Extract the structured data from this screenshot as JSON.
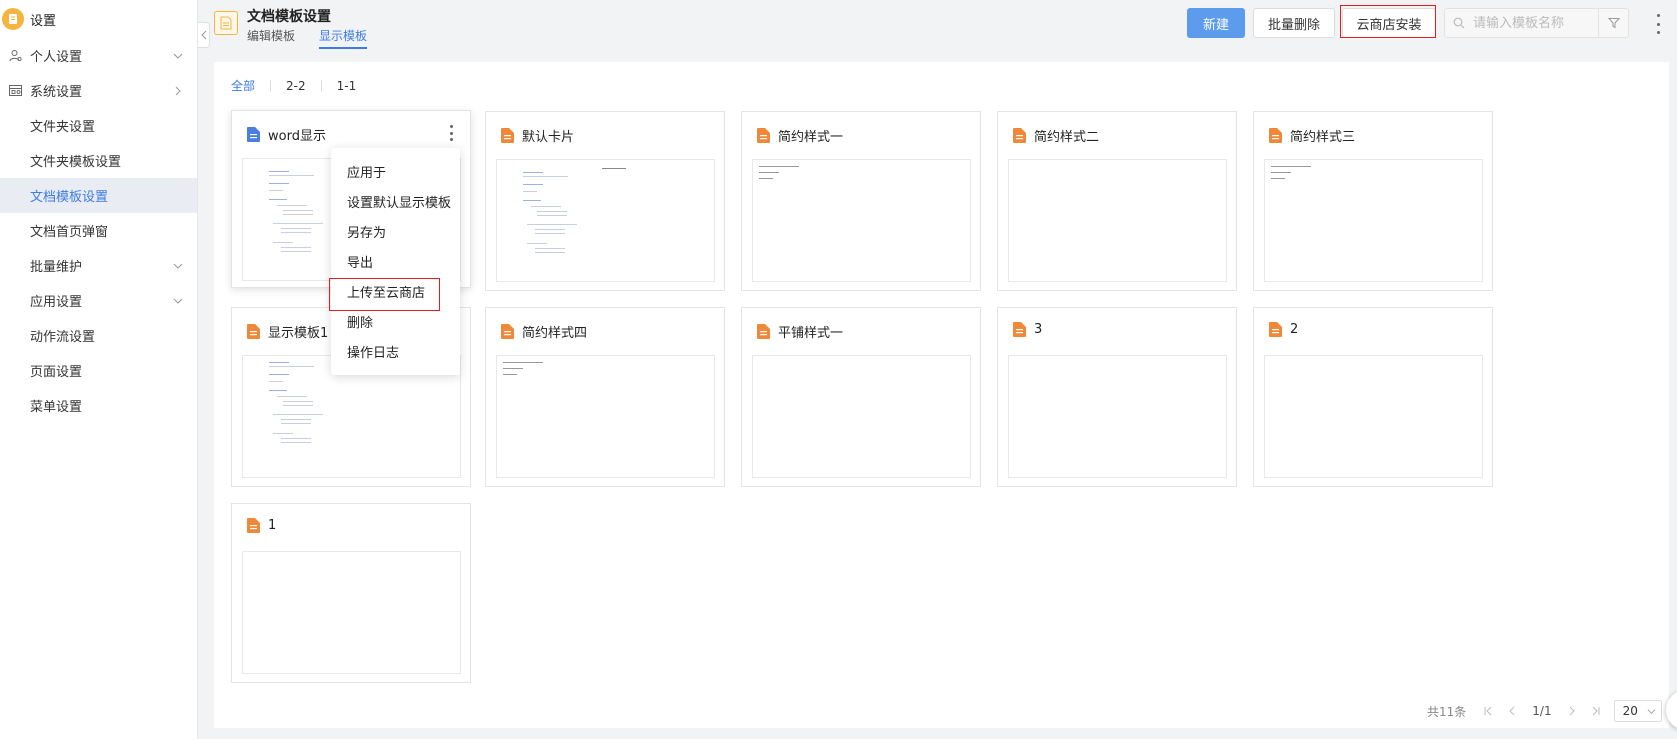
{
  "app": {
    "title": "设置"
  },
  "sidebar": {
    "items": [
      {
        "label": "个人设置",
        "level": "top",
        "icon": "user-icon",
        "chevron": "down"
      },
      {
        "label": "系统设置",
        "level": "top",
        "icon": "system-icon",
        "chevron": "right"
      },
      {
        "label": "文件夹设置",
        "level": "sub"
      },
      {
        "label": "文件夹模板设置",
        "level": "sub"
      },
      {
        "label": "文档模板设置",
        "level": "sub",
        "active": true
      },
      {
        "label": "文档首页弹窗",
        "level": "sub"
      },
      {
        "label": "批量维护",
        "level": "sub",
        "chevron": "down"
      },
      {
        "label": "应用设置",
        "level": "sub",
        "chevron": "down"
      },
      {
        "label": "动作流设置",
        "level": "sub"
      },
      {
        "label": "页面设置",
        "level": "sub"
      },
      {
        "label": "菜单设置",
        "level": "sub"
      }
    ]
  },
  "header": {
    "title": "文档模板设置",
    "tabs": [
      {
        "label": "编辑模板",
        "active": false
      },
      {
        "label": "显示模板",
        "active": true
      }
    ],
    "new_label": "新建",
    "batch_delete_label": "批量删除",
    "cloud_install_label": "云商店安装",
    "search_placeholder": "请输入模板名称"
  },
  "filters": [
    {
      "label": "全部",
      "active": true
    },
    {
      "label": "2-2",
      "active": false
    },
    {
      "label": "1-1",
      "active": false
    }
  ],
  "cards": [
    {
      "name": "word显示",
      "icon": "word-doc-icon"
    },
    {
      "name": "默认卡片",
      "icon": "doc-icon"
    },
    {
      "name": "简约样式一",
      "icon": "doc-icon"
    },
    {
      "name": "简约样式二",
      "icon": "doc-icon"
    },
    {
      "name": "简约样式三",
      "icon": "doc-icon"
    },
    {
      "name": "显示模板1",
      "icon": "doc-icon"
    },
    {
      "name": "简约样式四",
      "icon": "doc-icon"
    },
    {
      "name": "平铺样式一",
      "icon": "doc-icon"
    },
    {
      "name": "3",
      "icon": "doc-icon"
    },
    {
      "name": "2",
      "icon": "doc-icon"
    },
    {
      "name": "1",
      "icon": "doc-icon"
    }
  ],
  "context_menu": {
    "items": [
      "应用于",
      "设置默认显示模板",
      "另存为",
      "导出",
      "上传至云商店",
      "删除",
      "操作日志"
    ]
  },
  "pagination": {
    "total_label": "共11条",
    "page_info": "1/1",
    "page_size": "20"
  },
  "colors": {
    "primary": "#3c7be6",
    "primary_button": "#5d9cec",
    "doc_icon": "#f0883a",
    "word_icon": "#4a7fe0",
    "highlight": "#e02020"
  }
}
